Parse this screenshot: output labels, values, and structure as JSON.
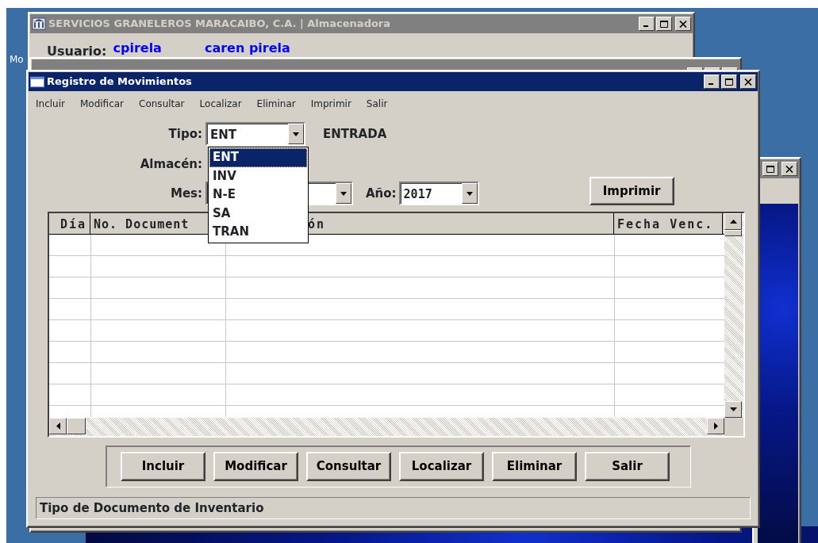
{
  "desktop": {
    "icon_label": "Mo"
  },
  "main_window": {
    "title": "SERVICIOS GRANELEROS MARACAIBO, C.A. | Almacenadora",
    "active": false,
    "user_label": "Usuario:",
    "username": "cpirela",
    "full_name": "caren pirela"
  },
  "active_window": {
    "title": "Registro de Movimientos",
    "active": true,
    "menu": [
      "Incluir",
      "Modificar",
      "Consultar",
      "Localizar",
      "Eliminar",
      "Imprimir",
      "Salir"
    ],
    "tipo": {
      "label": "Tipo:",
      "value": "ENT",
      "description": "ENTRADA",
      "options": [
        {
          "label": "ENT",
          "selected": true
        },
        {
          "label": "INV",
          "selected": false
        },
        {
          "label": "N-E",
          "selected": false
        },
        {
          "label": "SA",
          "selected": false
        },
        {
          "label": "TRAN",
          "selected": false
        }
      ]
    },
    "almacen": {
      "label": "Almacén:"
    },
    "mes": {
      "label": "Mes:"
    },
    "ano": {
      "label": "Año:",
      "value": "2017"
    },
    "print_button": "Imprimir",
    "grid": {
      "columns": [
        "Día",
        "No. Document",
        "ón",
        "Fecha Venc."
      ]
    },
    "buttons": [
      "Incluir",
      "Modificar",
      "Consultar",
      "Localizar",
      "Eliminar",
      "Salir"
    ],
    "status_bar": "Tipo de Documento de Inventario"
  }
}
